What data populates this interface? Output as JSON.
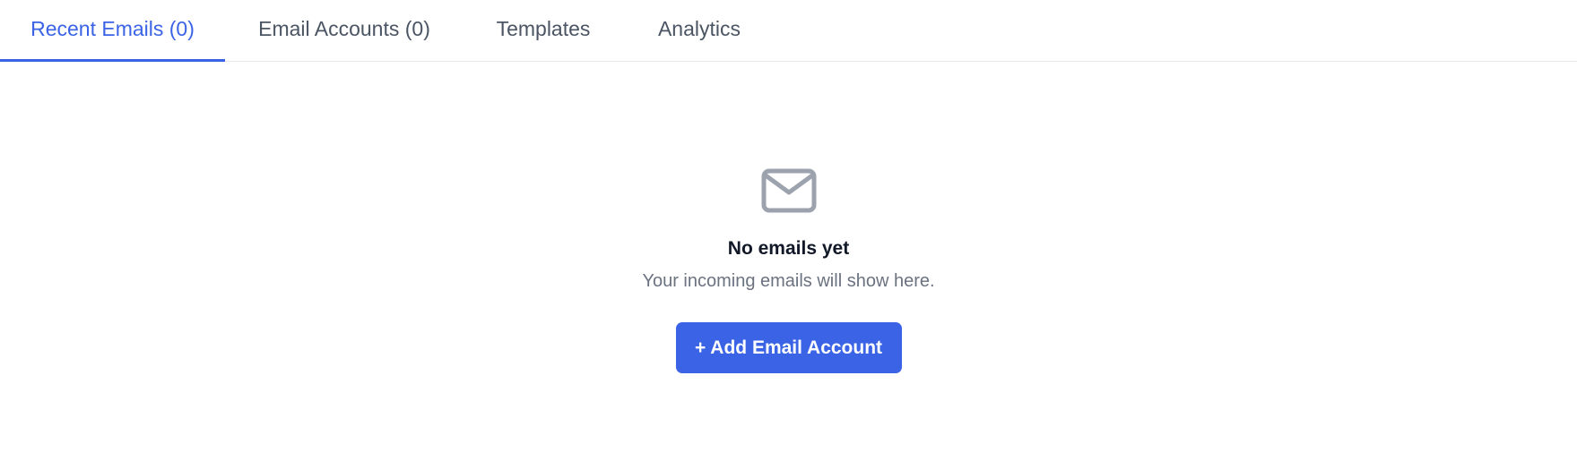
{
  "tabs": [
    {
      "label": "Recent Emails (0)",
      "active": true
    },
    {
      "label": "Email Accounts (0)",
      "active": false
    },
    {
      "label": "Templates",
      "active": false
    },
    {
      "label": "Analytics",
      "active": false
    }
  ],
  "empty_state": {
    "icon": "mail-icon",
    "title": "No emails yet",
    "subtitle": "Your incoming emails will show here.",
    "button_label": "+ Add Email Account"
  },
  "colors": {
    "accent": "#3b63e6",
    "icon": "#9ca3af",
    "title": "#111827",
    "subtitle": "#6b7280",
    "tab_inactive": "#4b5563",
    "divider": "#e5e7eb"
  }
}
